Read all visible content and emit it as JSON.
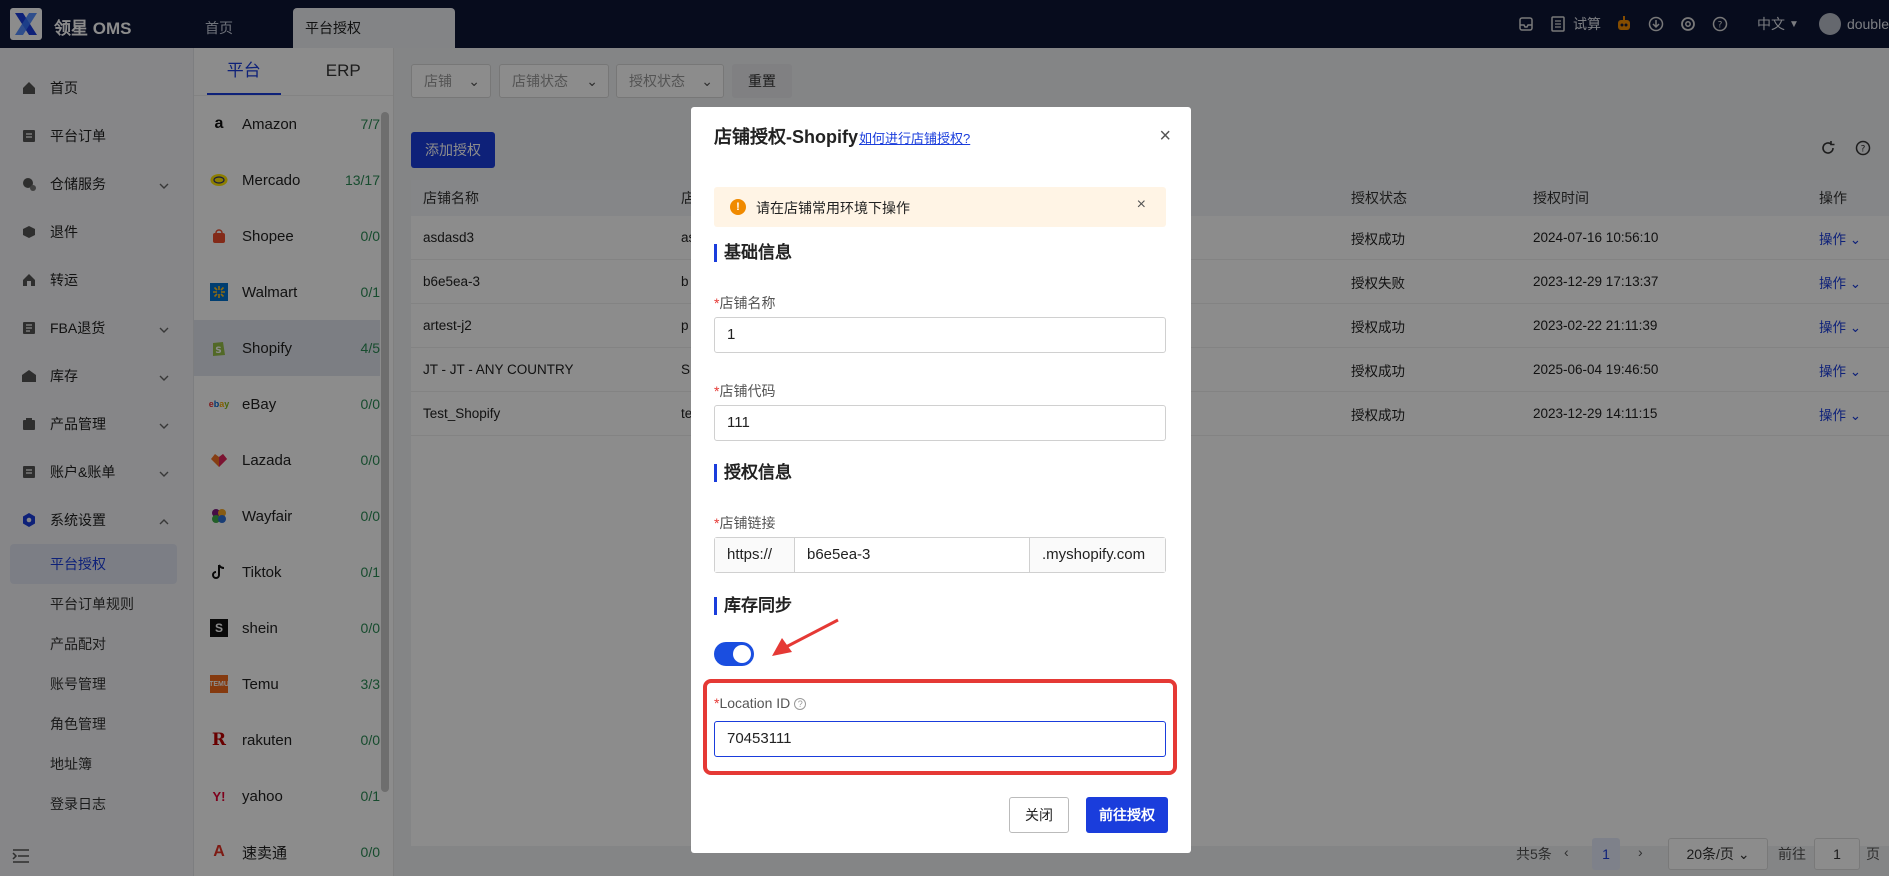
{
  "header": {
    "brand": "领星 OMS",
    "tabs": [
      {
        "label": "首页"
      },
      {
        "label": "平台授权"
      }
    ],
    "trial_label": "试算",
    "language": "中文",
    "user": "double"
  },
  "sidebar": {
    "items": [
      {
        "label": "首页"
      },
      {
        "label": "平台订单"
      },
      {
        "label": "仓储服务"
      },
      {
        "label": "退件"
      },
      {
        "label": "转运"
      },
      {
        "label": "FBA退货"
      },
      {
        "label": "库存"
      },
      {
        "label": "产品管理"
      },
      {
        "label": "账户&账单"
      },
      {
        "label": "系统设置"
      }
    ],
    "sub_items": [
      {
        "label": "平台授权"
      },
      {
        "label": "平台订单规则"
      },
      {
        "label": "产品配对"
      },
      {
        "label": "账号管理"
      },
      {
        "label": "角色管理"
      },
      {
        "label": "地址簿"
      },
      {
        "label": "登录日志"
      }
    ]
  },
  "platforms": {
    "tabs": [
      "平台",
      "ERP"
    ],
    "items": [
      {
        "name": "Amazon",
        "count": "7/7"
      },
      {
        "name": "Mercado",
        "count": "13/17"
      },
      {
        "name": "Shopee",
        "count": "0/0"
      },
      {
        "name": "Walmart",
        "count": "0/1"
      },
      {
        "name": "Shopify",
        "count": "4/5"
      },
      {
        "name": "eBay",
        "count": "0/0"
      },
      {
        "name": "Lazada",
        "count": "0/0"
      },
      {
        "name": "Wayfair",
        "count": "0/0"
      },
      {
        "name": "Tiktok",
        "count": "0/1"
      },
      {
        "name": "shein",
        "count": "0/0"
      },
      {
        "name": "Temu",
        "count": "3/3"
      },
      {
        "name": "rakuten",
        "count": "0/0"
      },
      {
        "name": "yahoo",
        "count": "0/1"
      },
      {
        "name": "速卖通",
        "count": "0/0"
      }
    ]
  },
  "main": {
    "filters": [
      "店铺",
      "店铺状态",
      "授权状态"
    ],
    "reset_label": "重置",
    "add_label": "添加授权",
    "columns": {
      "name": "店铺名称",
      "code": "店",
      "status": "授权状态",
      "time": "授权时间",
      "op": "操作"
    },
    "rows": [
      {
        "name": "asdasd3",
        "code": "as",
        "status": "授权成功",
        "time": "2024-07-16 10:56:10",
        "op": "操作"
      },
      {
        "name": "b6e5ea-3",
        "code": "b",
        "status": "授权失败",
        "time": "2023-12-29 17:13:37",
        "op": "操作"
      },
      {
        "name": "artest-j2",
        "code": "p",
        "status": "授权成功",
        "time": "2023-02-22 21:11:39",
        "op": "操作"
      },
      {
        "name": "JT - JT - ANY COUNTRY",
        "code": "S",
        "status": "授权成功",
        "time": "2025-06-04 19:46:50",
        "op": "操作"
      },
      {
        "name": "Test_Shopify",
        "code": "te",
        "status": "授权成功",
        "time": "2023-12-29 14:11:15",
        "op": "操作"
      }
    ],
    "pager": {
      "total": "共5条",
      "page": "1",
      "size": "20条/页",
      "goto": "前往",
      "goto_value": "1",
      "page_suffix": "页"
    }
  },
  "modal": {
    "title": "店铺授权-Shopify",
    "help_link": "如何进行店铺授权?",
    "alert": "请在店铺常用环境下操作",
    "section_basic": "基础信息",
    "store_name_label": "店铺名称",
    "store_name_value": "1",
    "store_code_label": "店铺代码",
    "store_code_value": "111",
    "section_auth": "授权信息",
    "store_link_label": "店铺链接",
    "url_prefix": "https://",
    "url_value": "b6e5ea-3",
    "url_suffix": ".myshopify.com",
    "section_stock": "库存同步",
    "stock_sync_enabled": true,
    "location_label": "Location ID",
    "location_value": "70453111",
    "close_label": "关闭",
    "submit_label": "前往授权"
  }
}
